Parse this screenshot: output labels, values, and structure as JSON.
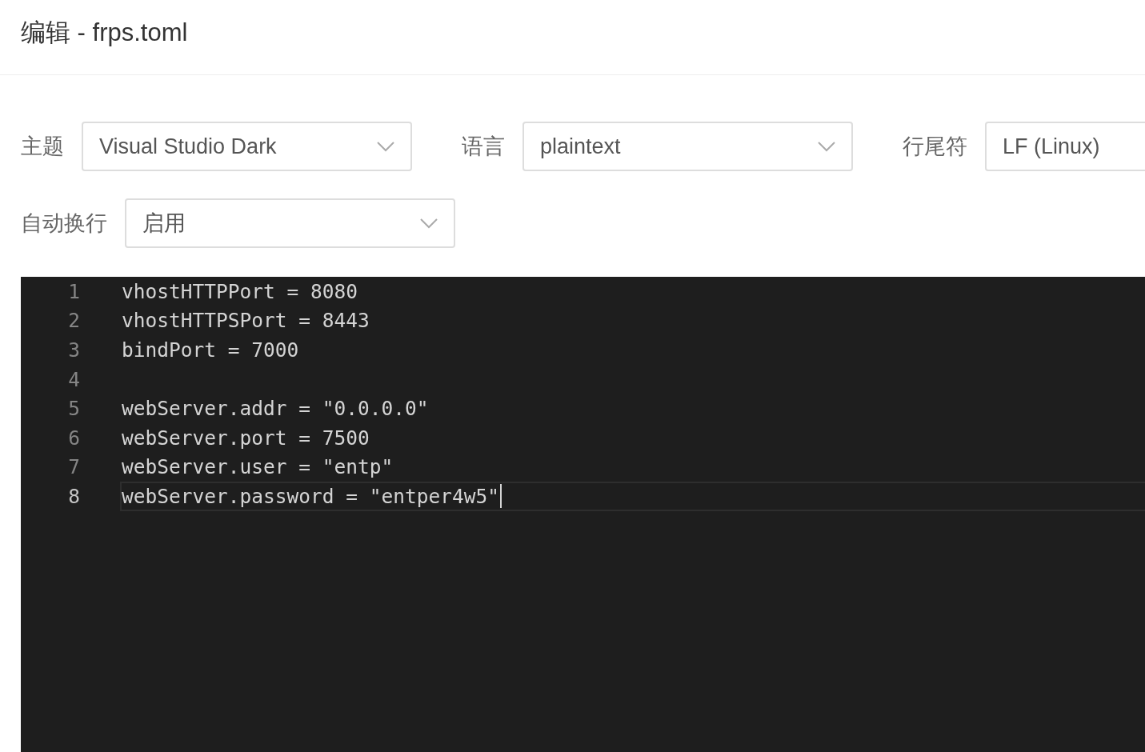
{
  "header": {
    "title": "编辑 - frps.toml"
  },
  "setting_rows": [
    [
      {
        "label": "主题",
        "value": "Visual Studio Dark"
      },
      {
        "label": "语言",
        "value": "plaintext"
      },
      {
        "label": "行尾符",
        "value": "LF (Linux)"
      }
    ],
    [
      {
        "label": "自动换行",
        "value": "启用"
      }
    ]
  ],
  "editor": {
    "lines": [
      {
        "number": "1",
        "text": "vhostHTTPPort = 8080",
        "current": false
      },
      {
        "number": "2",
        "text": "vhostHTTPSPort = 8443",
        "current": false
      },
      {
        "number": "3",
        "text": "bindPort = 7000",
        "current": false
      },
      {
        "number": "4",
        "current": false
      },
      {
        "number": "5",
        "text": "webServer.addr = \"0.0.0.0\"",
        "current": false
      },
      {
        "number": "6",
        "text": "webServer.port = 7500",
        "current": false
      },
      {
        "number": "7",
        "text": "webServer.user = \"entp\"",
        "current": false
      },
      {
        "number": "8",
        "text": "webServer.password = \"entper4w5\"",
        "current": true
      }
    ]
  }
}
